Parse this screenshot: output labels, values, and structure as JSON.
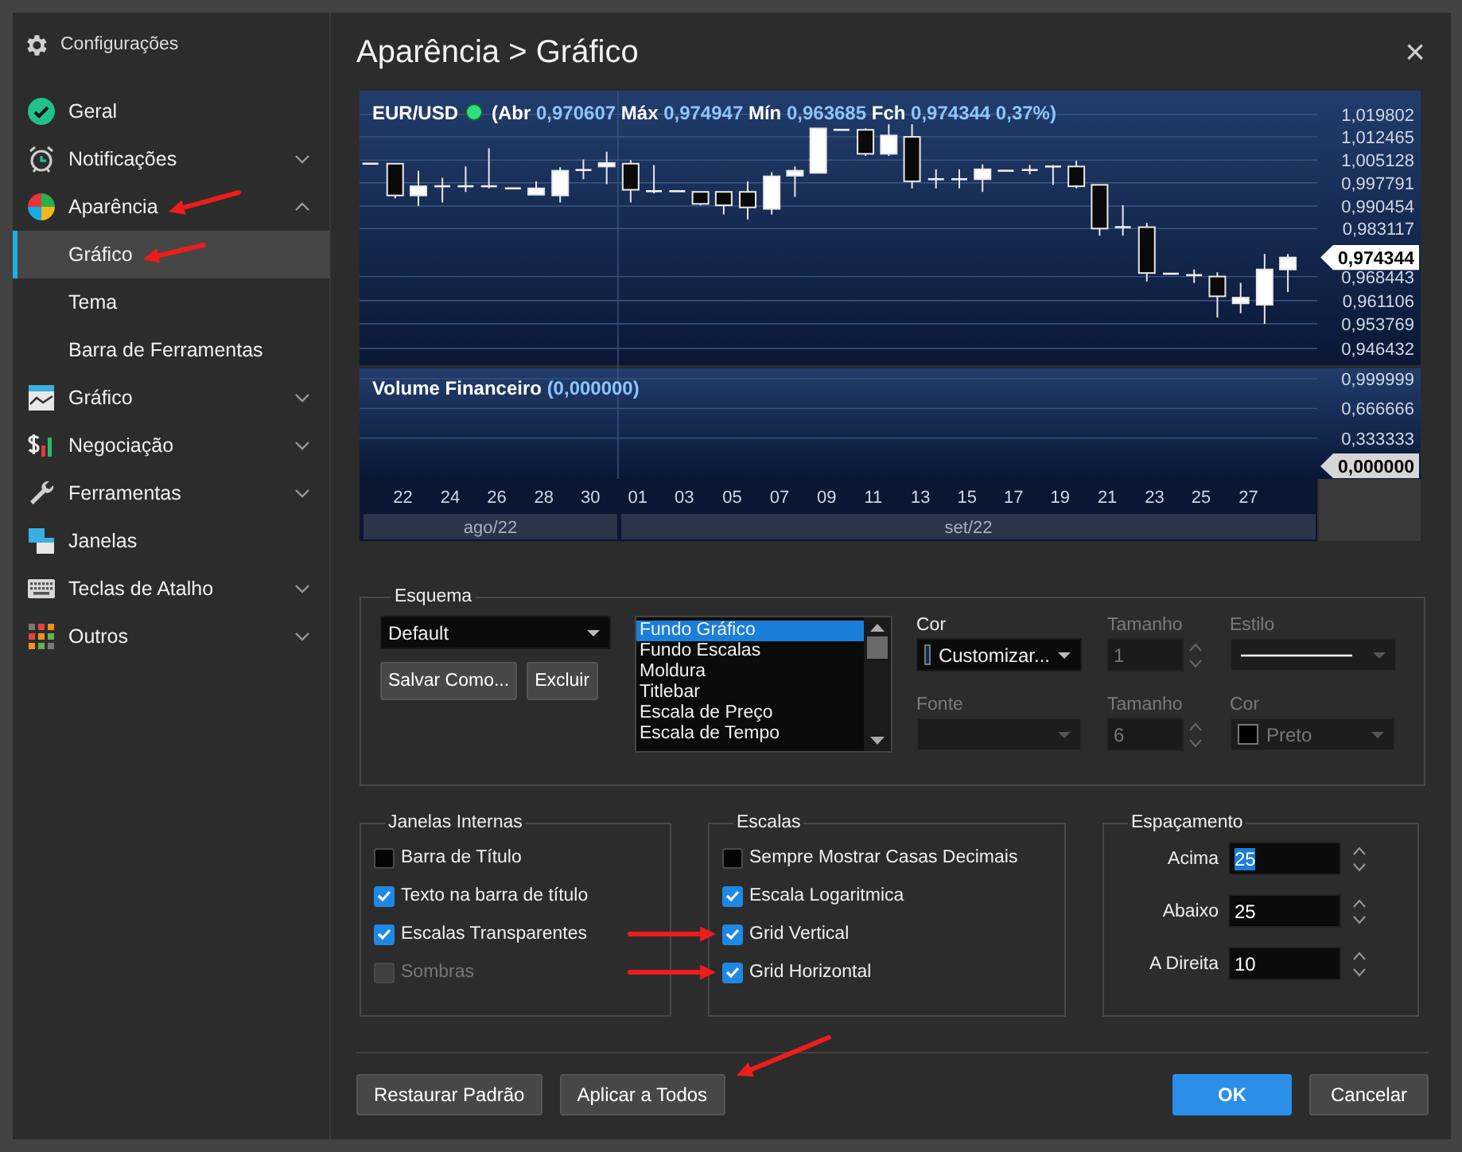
{
  "sidebar": {
    "title": "Configurações",
    "items": [
      {
        "label": "Geral",
        "kind": "page",
        "selected": false,
        "arrow": false
      },
      {
        "label": "Notificações",
        "kind": "folder",
        "expanded": false,
        "selected": false,
        "arrow": false
      },
      {
        "label": "Aparência",
        "kind": "folder",
        "expanded": true,
        "selected": false,
        "arrow": true,
        "children": [
          {
            "label": "Gráfico",
            "selected": true,
            "arrow": true
          },
          {
            "label": "Tema",
            "selected": false,
            "arrow": false
          },
          {
            "label": "Barra de Ferramentas",
            "selected": false,
            "arrow": false
          }
        ]
      },
      {
        "label": "Gráfico",
        "kind": "folder",
        "expanded": false,
        "selected": false,
        "arrow": false
      },
      {
        "label": "Negociação",
        "kind": "folder",
        "expanded": false,
        "selected": false,
        "arrow": false
      },
      {
        "label": "Ferramentas",
        "kind": "folder",
        "expanded": false,
        "selected": false,
        "arrow": false
      },
      {
        "label": "Janelas",
        "kind": "page",
        "selected": false,
        "arrow": false
      },
      {
        "label": "Teclas de Atalho",
        "kind": "folder",
        "expanded": false,
        "selected": false,
        "arrow": false
      },
      {
        "label": "Outros",
        "kind": "folder",
        "expanded": false,
        "selected": false,
        "arrow": false
      }
    ]
  },
  "title": "Aparência > Gráfico",
  "close": "×",
  "chart": {
    "symbol": "EUR/USD",
    "quote": [
      {
        "label": "(Abr",
        "value": "0,970607"
      },
      {
        "label": "Máx",
        "value": "0,974947"
      },
      {
        "label": "Mín",
        "value": "0,963685"
      },
      {
        "label": "Fch",
        "value": "0,974344 0,37%)"
      }
    ],
    "price_ticks": [
      "1,019802",
      "1,012465",
      "1,005128",
      "0,997791",
      "0,990454",
      "0,983117",
      "0,968443",
      "0,961106",
      "0,953769",
      "0,946432"
    ],
    "last_price": "0,974344",
    "volume_title": "Volume Financeiro",
    "volume_value": "(0,000000)",
    "volume_ticks": [
      "0,999999",
      "0,666666",
      "0,333333"
    ],
    "last_volume": "0,000000",
    "dates": [
      "22",
      "24",
      "26",
      "28",
      "30",
      "01",
      "03",
      "05",
      "07",
      "09",
      "11",
      "13",
      "15",
      "17",
      "19",
      "21",
      "23",
      "25",
      "27"
    ],
    "months": [
      "ago/22",
      "set/22"
    ]
  },
  "scheme": {
    "legend": "Esquema",
    "preset": "Default",
    "save_button": "Salvar Como...",
    "delete_button": "Excluir",
    "elements": [
      {
        "label": "Fundo Gráfico",
        "selected": true
      },
      {
        "label": "Fundo Escalas",
        "selected": false
      },
      {
        "label": "Moldura",
        "selected": false
      },
      {
        "label": "Titlebar",
        "selected": false
      },
      {
        "label": "Escala de Preço",
        "selected": false
      },
      {
        "label": "Escala de Tempo",
        "selected": false
      }
    ],
    "fields": [
      {
        "label": "Cor",
        "kind": "color",
        "value": "Customizar...",
        "color": "#0e2a50",
        "disabled": false
      },
      {
        "label": "Tamanho",
        "kind": "spin",
        "value": "1",
        "disabled": true
      },
      {
        "label": "Estilo",
        "kind": "line",
        "disabled": true
      },
      {
        "label": "Fonte",
        "kind": "combo",
        "disabled": true
      },
      {
        "label": "Tamanho",
        "kind": "spin",
        "value": "6",
        "disabled": true
      },
      {
        "label": "Cor",
        "kind": "color",
        "value": "Preto",
        "color": "#000000",
        "disabled": true
      }
    ]
  },
  "windows_group": {
    "legend": "Janelas Internas",
    "options": [
      {
        "label": "Barra de Título",
        "checked": false,
        "disabled": false,
        "arrow": false
      },
      {
        "label": "Texto na barra de título",
        "checked": true,
        "disabled": false,
        "arrow": false
      },
      {
        "label": "Escalas Transparentes",
        "checked": true,
        "disabled": false,
        "arrow": false
      },
      {
        "label": "Sombras",
        "checked": false,
        "disabled": true,
        "arrow": false
      }
    ]
  },
  "scales_group": {
    "legend": "Escalas",
    "options": [
      {
        "label": "Sempre Mostrar Casas Decimais",
        "checked": false,
        "disabled": false,
        "arrow": false
      },
      {
        "label": "Escala Logaritmica",
        "checked": true,
        "disabled": false,
        "arrow": false
      },
      {
        "label": "Grid Vertical",
        "checked": true,
        "disabled": false,
        "arrow": true
      },
      {
        "label": "Grid Horizontal",
        "checked": true,
        "disabled": false,
        "arrow": true
      }
    ]
  },
  "spacing_group": {
    "legend": "Espaçamento",
    "fields": [
      {
        "label": "Acima",
        "value": "25",
        "text_selected": true
      },
      {
        "label": "Abaixo",
        "value": "25",
        "text_selected": false
      },
      {
        "label": "A Direita",
        "value": "10",
        "text_selected": false
      }
    ]
  },
  "footer": {
    "buttons": [
      {
        "label": "Restaurar Padrão",
        "primary": false,
        "arrow": false
      },
      {
        "label": "Aplicar a Todos",
        "primary": false,
        "arrow": true
      },
      {
        "label": "OK",
        "primary": true,
        "arrow": false
      },
      {
        "label": "Cancelar",
        "primary": false,
        "arrow": false
      }
    ]
  }
}
